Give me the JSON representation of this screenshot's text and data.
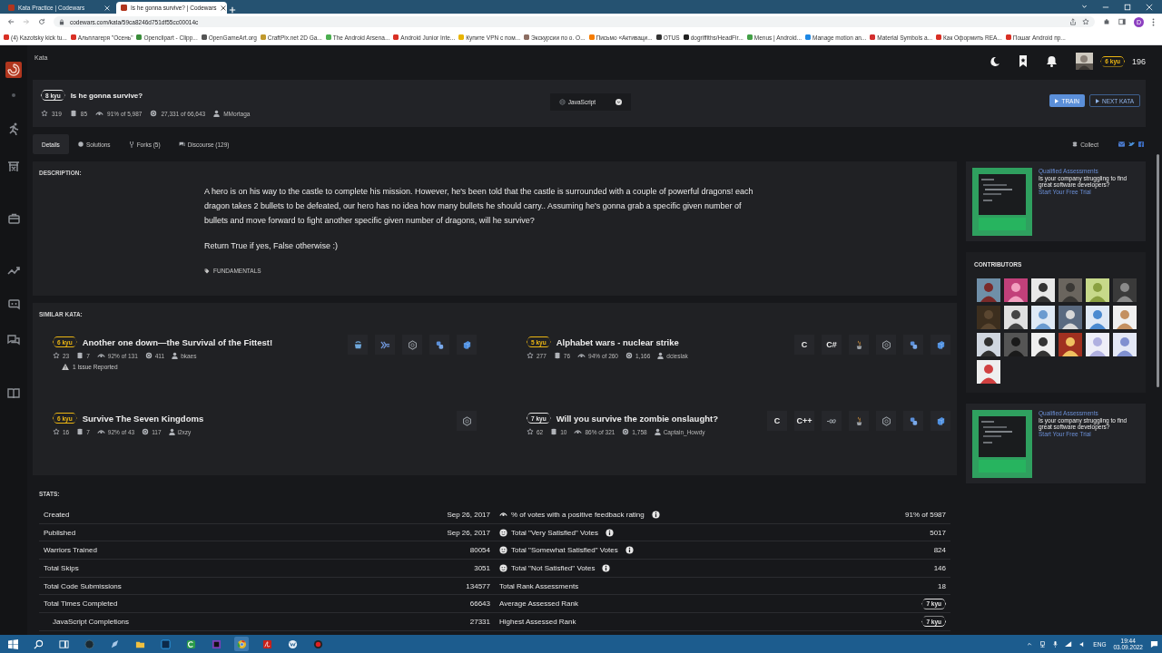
{
  "browser": {
    "tabs": [
      {
        "title": "Kata Practice | Codewars",
        "selected": false
      },
      {
        "title": "Is he gonna survive? | Codewars",
        "selected": true
      }
    ],
    "url": "codewars.com/kata/59ca8246d751df55cc00014c",
    "profile": "D",
    "bookmarks": [
      "(4) Kazotsky kick tu...",
      "Альплагеря \"Осень\"",
      "Openclipart - Clipp...",
      "OpenGameArt.org",
      "CraftPix.net 2D Ga...",
      "The Android Arsena...",
      "Android Junior Inte...",
      "Купите VPN с пом...",
      "Экскурсии по о. О...",
      "Письмо «Активаци...",
      "OTUS",
      "dogriffiths/HeadFir...",
      "Menus | Android...",
      "Manage motion an...",
      "Material Symbols a...",
      "Как Оформить REA...",
      "Пошаг Android пр..."
    ]
  },
  "header": {
    "breadcrumb": "Kata",
    "user_rank": "6 kyu",
    "honor": "196"
  },
  "kata": {
    "rank": "8 kyu",
    "title": "Is he gonna survive?",
    "favorites": "319",
    "collections": "85",
    "satisfaction": "91% of 5,987",
    "completions": "27,331 of 66,643",
    "author": "MMortaga",
    "language": "JavaScript",
    "buttons": [
      {
        "label": "TRAIN",
        "kind": "primary"
      },
      {
        "label": "NEXT KATA",
        "kind": "outline"
      }
    ],
    "tabs": [
      {
        "label": "Details",
        "selected": true
      },
      {
        "label": "Solutions",
        "selected": false
      },
      {
        "label": "Forks (5)",
        "selected": false
      },
      {
        "label": "Discourse (129)",
        "selected": false
      }
    ],
    "collect": "Collect"
  },
  "description": {
    "heading": "DESCRIPTION:",
    "paragraphs": [
      "A hero is on his way to the castle to complete his mission. However, he's been told that the castle is surrounded with a couple of powerful dragons! each dragon takes 2 bullets to be defeated, our hero has no idea how many bullets he should carry.. Assuming he's gonna grab a specific given number of bullets and move forward to fight another specific given number of dragons, will he survive?",
      "Return True if yes, False otherwise :)"
    ],
    "tags": [
      "FUNDAMENTALS"
    ]
  },
  "similar": {
    "heading": "SIMILAR KATA:",
    "items": [
      {
        "rank": "6 kyu",
        "color": "#ecb613",
        "title": "Another one down—the Survival of the Fittest!",
        "favorites": "23",
        "collections": "7",
        "satisfaction": "92% of 131",
        "completions": "411",
        "author": "bkaes",
        "issue": "1 Issue Reported",
        "languages": [
          {
            "kind": "coffee"
          },
          {
            "kind": "haskell"
          },
          {
            "kind": "hexagon"
          },
          {
            "kind": "snake"
          },
          {
            "kind": "cube"
          }
        ]
      },
      {
        "rank": "5 kyu",
        "color": "#ecb613",
        "title": "Alphabet wars - nuclear strike",
        "favorites": "277",
        "collections": "76",
        "satisfaction": "94% of 260",
        "completions": "1,166",
        "author": "dcieslak",
        "languages": [
          {
            "kind": "text",
            "label": "C"
          },
          {
            "kind": "text",
            "label": "C#"
          },
          {
            "kind": "cup"
          },
          {
            "kind": "hexagon"
          },
          {
            "kind": "snake"
          },
          {
            "kind": "cube"
          }
        ]
      },
      {
        "rank": "6 kyu",
        "color": "#ecb613",
        "title": "Survive The Seven Kingdoms",
        "favorites": "16",
        "collections": "7",
        "satisfaction": "92% of 43",
        "completions": "117",
        "author": "i2xzy",
        "languages": [
          {
            "kind": "hexagon"
          }
        ]
      },
      {
        "rank": "7 kyu",
        "color": "#e6e6e6",
        "title": "Will you survive the zombie onslaught?",
        "favorites": "62",
        "collections": "10",
        "satisfaction": "86% of 321",
        "completions": "1,758",
        "author": "Captain_Howdy",
        "languages": [
          {
            "kind": "text",
            "label": "C"
          },
          {
            "kind": "text",
            "label": "C++"
          },
          {
            "kind": "infinity"
          },
          {
            "kind": "cup"
          },
          {
            "kind": "hexagon"
          },
          {
            "kind": "snake"
          },
          {
            "kind": "cube"
          }
        ]
      }
    ]
  },
  "stats": {
    "heading": "STATS:",
    "rows": [
      {
        "left": {
          "label": "Created",
          "value": "Sep 26, 2017"
        },
        "right": {
          "kind": "feedback",
          "label": "% of votes with a positive feedback rating",
          "info": true,
          "value": "91% of 5987"
        }
      },
      {
        "left": {
          "label": "Published",
          "value": "Sep 26, 2017"
        },
        "right": {
          "kind": "vote",
          "label": "Total \"Very Satisfied\" Votes",
          "info": true,
          "value": "5017"
        }
      },
      {
        "left": {
          "label": "Warriors Trained",
          "value": "80054"
        },
        "right": {
          "kind": "vote",
          "label": "Total \"Somewhat Satisfied\" Votes",
          "info": true,
          "value": "824"
        }
      },
      {
        "left": {
          "label": "Total Skips",
          "value": "3051"
        },
        "right": {
          "kind": "vote",
          "label": "Total \"Not Satisfied\" Votes",
          "info": true,
          "value": "146"
        }
      },
      {
        "left": {
          "label": "Total Code Submissions",
          "value": "134577"
        },
        "right": {
          "kind": "plain",
          "label": "Total Rank Assessments",
          "info": false,
          "value": "18"
        }
      },
      {
        "left": {
          "label": "Total Times Completed",
          "value": "66643"
        },
        "right": {
          "kind": "plain",
          "label": "Average Assessed Rank",
          "info": false,
          "value": "7 kyu",
          "badge": true
        }
      },
      {
        "left": {
          "label": "JavaScript Completions",
          "value": "27331",
          "indent": true
        },
        "right": {
          "kind": "plain",
          "label": "Highest Assessed Rank",
          "info": false,
          "value": "7 kyu",
          "badge": true
        }
      }
    ]
  },
  "aside": {
    "ads": [
      {
        "title": "Qualified Assessments",
        "text": "Is your company struggling to find great software developers?",
        "link": "Start Your Free Trial"
      },
      {
        "title": "Qualified Assessments",
        "text": "Is your company struggling to find great software developers?",
        "link": "Start Your Free Trial"
      }
    ],
    "contributors": {
      "heading": "CONTRIBUTORS"
    }
  },
  "taskbar": {
    "language": "ENG",
    "time": "19:44",
    "date": "03.09.2022"
  }
}
